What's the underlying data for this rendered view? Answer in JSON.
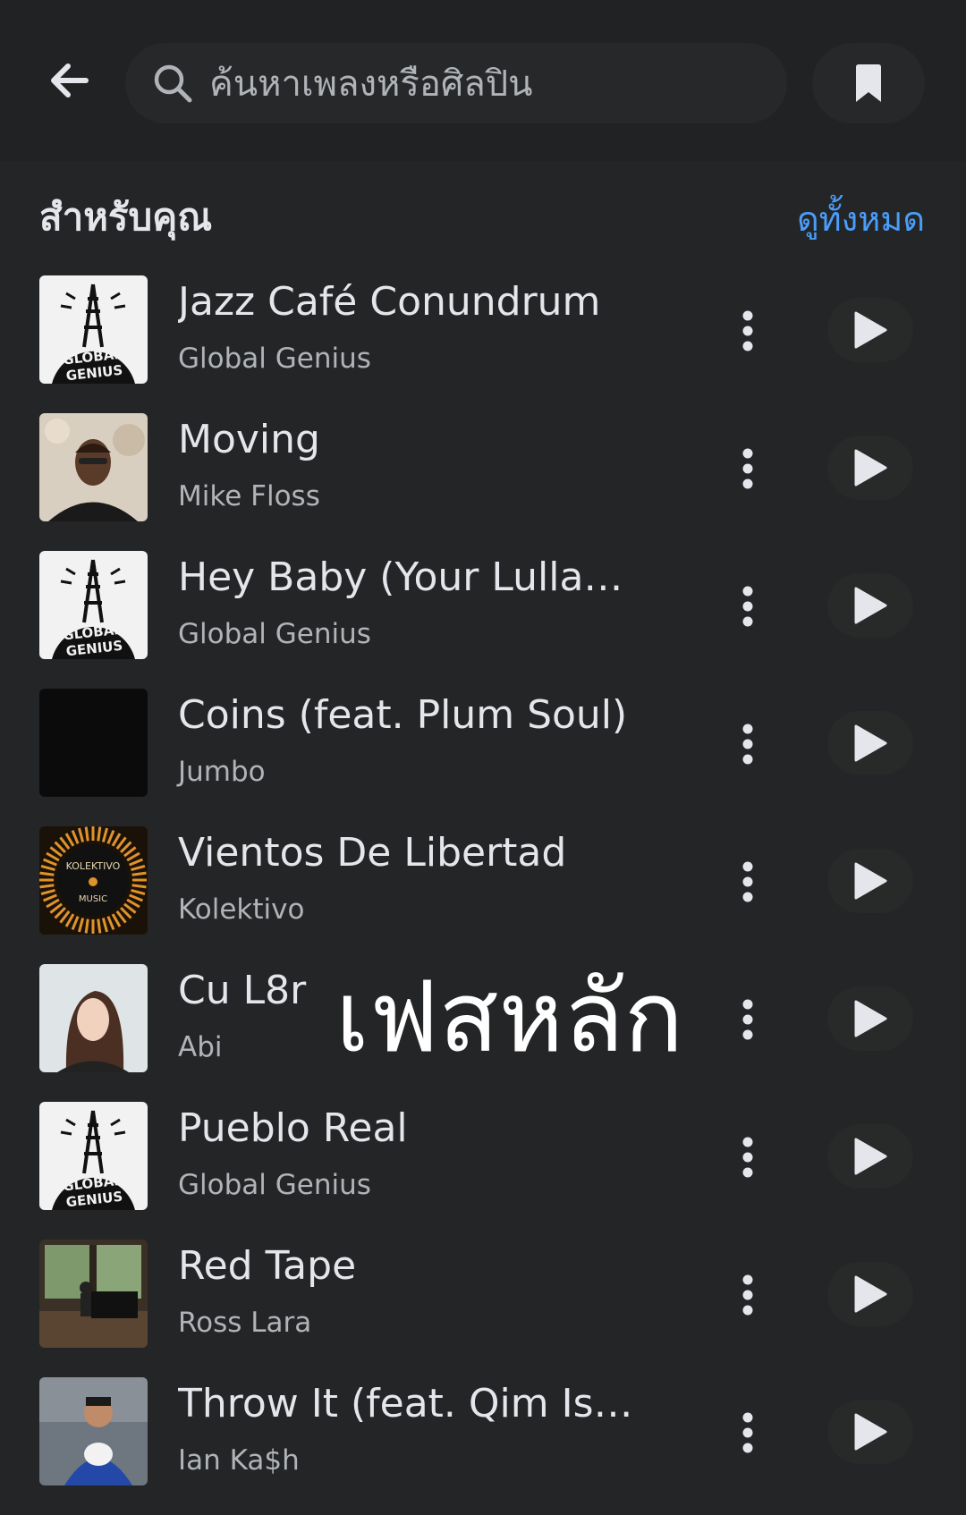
{
  "search": {
    "placeholder": "ค้นหาเพลงหรือศิลปิน"
  },
  "section": {
    "title": "สำหรับคุณ",
    "see_all": "ดูทั้งหมด"
  },
  "colors": {
    "background": "#242526",
    "accent": "#4a9df8",
    "primary_text": "#e4e6eb",
    "secondary_text": "#b0b3b8"
  },
  "songs": [
    {
      "title": "Jazz Café Conundrum",
      "artist": "Global Genius",
      "art": "global-genius",
      "art_text": [
        "GLOBAL",
        "GENIUS"
      ]
    },
    {
      "title": "Moving",
      "artist": "Mike Floss",
      "art": "portrait-man"
    },
    {
      "title": "Hey Baby (Your Lullaby…",
      "artist": "Global Genius",
      "art": "global-genius",
      "art_text": [
        "GLOBAL",
        "GENIUS"
      ]
    },
    {
      "title": "Coins (feat. Plum Soul)",
      "artist": "Jumbo",
      "art": "black"
    },
    {
      "title": "Vientos De Libertad",
      "artist": "Kolektivo",
      "art": "kolektivo",
      "art_text": [
        "KOLEKTIVO",
        "MUSIC"
      ]
    },
    {
      "title": "Cu L8r",
      "artist": "Abi",
      "art": "portrait-woman"
    },
    {
      "title": "Pueblo Real",
      "artist": "Global Genius",
      "art": "global-genius",
      "art_text": [
        "GLOBAL",
        "GENIUS"
      ]
    },
    {
      "title": "Red Tape",
      "artist": "Ross Lara",
      "art": "piano-room"
    },
    {
      "title": "Throw It (feat. Qim Isle)",
      "artist": "Ian Ka$h",
      "art": "kid-dog"
    }
  ],
  "overlay": {
    "caption": "เฟสหลัก"
  }
}
